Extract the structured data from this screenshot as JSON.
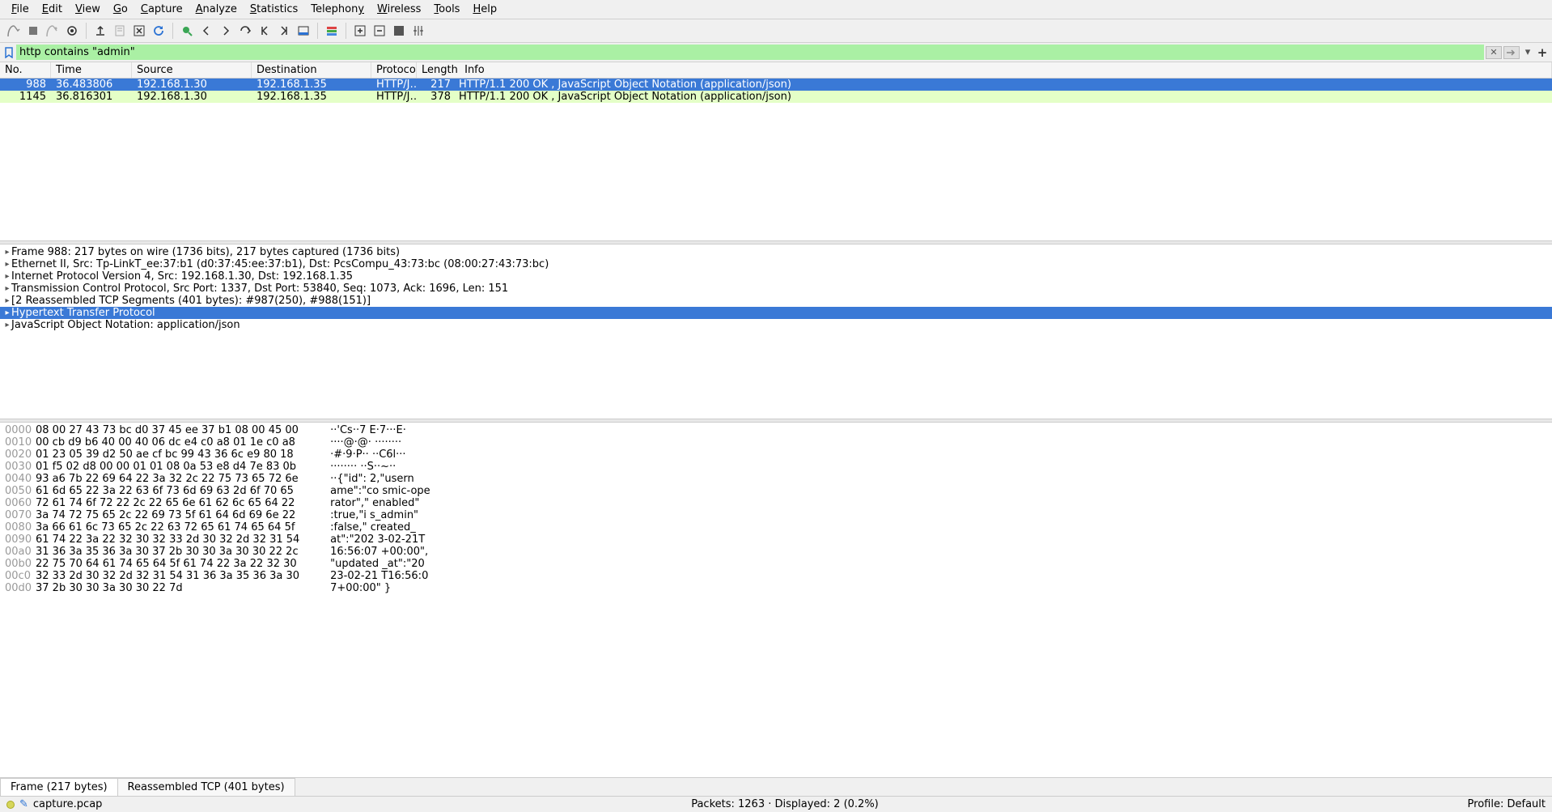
{
  "menu": {
    "file": "File",
    "edit": "Edit",
    "view": "View",
    "go": "Go",
    "capture": "Capture",
    "analyze": "Analyze",
    "statistics": "Statistics",
    "telephony": "Telephony",
    "wireless": "Wireless",
    "tools": "Tools",
    "help": "Help"
  },
  "filter": {
    "value": "http contains \"admin\""
  },
  "columns": {
    "no": "No.",
    "time": "Time",
    "src": "Source",
    "dst": "Destination",
    "proto": "Protocol",
    "len": "Length",
    "info": "Info"
  },
  "packets": [
    {
      "no": "988",
      "time": "36.483806",
      "src": "192.168.1.30",
      "dst": "192.168.1.35",
      "proto": "HTTP/J…",
      "len": "217",
      "info": "HTTP/1.1 200 OK , JavaScript Object Notation (application/json)",
      "selected": true
    },
    {
      "no": "1145",
      "time": "36.816301",
      "src": "192.168.1.30",
      "dst": "192.168.1.35",
      "proto": "HTTP/J…",
      "len": "378",
      "info": "HTTP/1.1 200 OK , JavaScript Object Notation (application/json)",
      "selected": false
    }
  ],
  "details": [
    {
      "text": "Frame 988: 217 bytes on wire (1736 bits), 217 bytes captured (1736 bits)",
      "sel": false
    },
    {
      "text": "Ethernet II, Src: Tp-LinkT_ee:37:b1 (d0:37:45:ee:37:b1), Dst: PcsCompu_43:73:bc (08:00:27:43:73:bc)",
      "sel": false
    },
    {
      "text": "Internet Protocol Version 4, Src: 192.168.1.30, Dst: 192.168.1.35",
      "sel": false
    },
    {
      "text": "Transmission Control Protocol, Src Port: 1337, Dst Port: 53840, Seq: 1073, Ack: 1696, Len: 151",
      "sel": false
    },
    {
      "text": "[2 Reassembled TCP Segments (401 bytes): #987(250), #988(151)]",
      "sel": false
    },
    {
      "text": "Hypertext Transfer Protocol",
      "sel": true
    },
    {
      "text": "JavaScript Object Notation: application/json",
      "sel": false
    }
  ],
  "hex": [
    {
      "off": "0000",
      "b": "08 00 27 43 73 bc d0 37  45 ee 37 b1 08 00 45 00",
      "a": "··'Cs··7 E·7···E·"
    },
    {
      "off": "0010",
      "b": "00 cb d9 b6 40 00 40 06  dc e4 c0 a8 01 1e c0 a8",
      "a": "····@·@· ········"
    },
    {
      "off": "0020",
      "b": "01 23 05 39 d2 50 ae cf  bc 99 43 36 6c e9 80 18",
      "a": "·#·9·P·· ··C6l···"
    },
    {
      "off": "0030",
      "b": "01 f5 02 d8 00 00 01 01  08 0a 53 e8 d4 7e 83 0b",
      "a": "········ ··S··~··"
    },
    {
      "off": "0040",
      "b": "93 a6 7b 22 69 64 22 3a  32 2c 22 75 73 65 72 6e",
      "a": "··{\"id\": 2,\"usern"
    },
    {
      "off": "0050",
      "b": "61 6d 65 22 3a 22 63 6f  73 6d 69 63 2d 6f 70 65",
      "a": "ame\":\"co smic-ope"
    },
    {
      "off": "0060",
      "b": "72 61 74 6f 72 22 2c 22  65 6e 61 62 6c 65 64 22",
      "a": "rator\",\" enabled\""
    },
    {
      "off": "0070",
      "b": "3a 74 72 75 65 2c 22 69  73 5f 61 64 6d 69 6e 22",
      "a": ":true,\"i s_admin\""
    },
    {
      "off": "0080",
      "b": "3a 66 61 6c 73 65 2c 22  63 72 65 61 74 65 64 5f",
      "a": ":false,\" created_"
    },
    {
      "off": "0090",
      "b": "61 74 22 3a 22 32 30 32  33 2d 30 32 2d 32 31 54",
      "a": "at\":\"202 3-02-21T"
    },
    {
      "off": "00a0",
      "b": "31 36 3a 35 36 3a 30 37  2b 30 30 3a 30 30 22 2c",
      "a": "16:56:07 +00:00\","
    },
    {
      "off": "00b0",
      "b": "22 75 70 64 61 74 65 64  5f 61 74 22 3a 22 32 30",
      "a": "\"updated _at\":\"20"
    },
    {
      "off": "00c0",
      "b": "32 33 2d 30 32 2d 32 31  54 31 36 3a 35 36 3a 30",
      "a": "23-02-21 T16:56:0"
    },
    {
      "off": "00d0",
      "b": "37 2b 30 30 3a 30 30 22  7d                     ",
      "a": "7+00:00\" }"
    }
  ],
  "tabs": {
    "frame": "Frame (217 bytes)",
    "reasm": "Reassembled TCP (401 bytes)"
  },
  "status": {
    "file": "capture.pcap",
    "packets": "Packets: 1263 · Displayed: 2 (0.2%)",
    "profile": "Profile: Default"
  }
}
